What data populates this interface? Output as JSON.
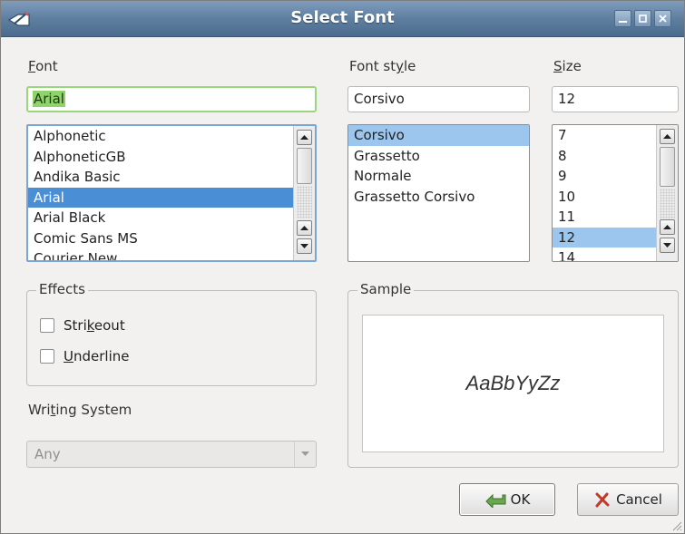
{
  "window": {
    "title": "Select Font",
    "icon": "font-pen-icon",
    "controls": [
      "minimize-icon",
      "maximize-icon",
      "close-icon"
    ]
  },
  "font": {
    "label": "Font",
    "label_mnemonic": "F",
    "label_rest": "ont",
    "value": "Arial",
    "items": [
      "Alphonetic",
      "AlphoneticGB",
      "Andika Basic",
      "Arial",
      "Arial Black",
      "Comic Sans MS",
      "Courier New"
    ],
    "selected": "Arial"
  },
  "style": {
    "label_a": "Font st",
    "label_mnemonic": "y",
    "label_b": "le",
    "value": "Corsivo",
    "items": [
      "Corsivo",
      "Grassetto",
      "Normale",
      "Grassetto Corsivo"
    ],
    "selected": "Corsivo"
  },
  "size": {
    "label_mnemonic": "S",
    "label_rest": "ize",
    "value": "12",
    "items": [
      "7",
      "8",
      "9",
      "10",
      "11",
      "12",
      "14"
    ],
    "selected": "12"
  },
  "effects": {
    "legend": "Effects",
    "strikeout_a": "Stri",
    "strikeout_mnemonic": "k",
    "strikeout_b": "eout",
    "strikeout_checked": false,
    "underline_mnemonic": "U",
    "underline_rest": "nderline",
    "underline_checked": false
  },
  "writing_system": {
    "label_a": "Wri",
    "label_mnemonic": "t",
    "label_b": "ing System",
    "value": "Any"
  },
  "sample": {
    "legend": "Sample",
    "text": "AaBbYyZz"
  },
  "buttons": {
    "ok": "OK",
    "cancel": "Cancel"
  },
  "colors": {
    "titlebar": "#5f7fa1",
    "selection": "#4a8fd6",
    "selection_light": "#9cc6ee",
    "focus_field": "#8ed36b"
  }
}
